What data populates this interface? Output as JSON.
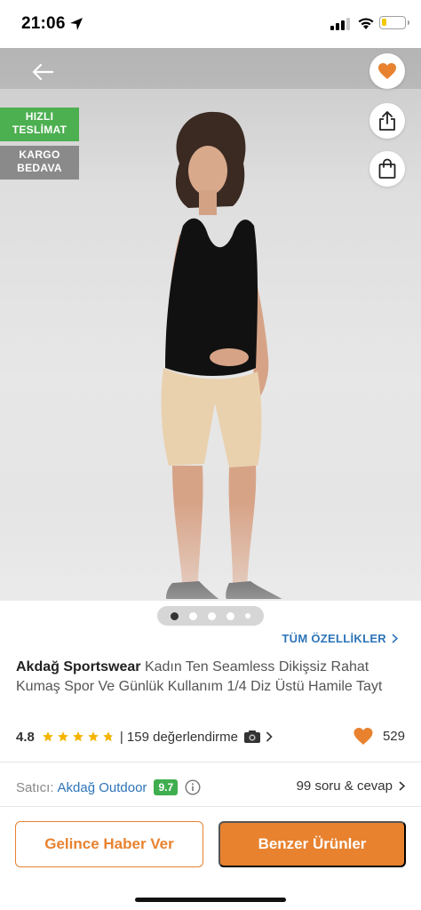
{
  "status_bar": {
    "time": "21:06",
    "battery_level": 0.22,
    "battery_color": "#f2c800"
  },
  "hero": {
    "badges": {
      "fast_delivery_line1": "HIZLI",
      "fast_delivery_line2": "TESLİMAT",
      "free_cargo_line1": "KARGO",
      "free_cargo_line2": "BEDAVA"
    },
    "icons": [
      "back-arrow-icon",
      "heart-icon",
      "share-icon",
      "shopping-bag-icon"
    ],
    "image_count": 5,
    "active_image_index": 1
  },
  "product": {
    "all_features_label": "TÜM ÖZELLİKLER",
    "brand": "Akdağ Sportswear",
    "name": "Kadın Ten Seamless Dikişsiz Rahat Kumaş Spor Ve Günlük Kullanım 1/4 Diz Üstü Hamile Tayt",
    "rating": "4.8",
    "rating_value": 4.8,
    "review_text": "| 159 değerlendirme",
    "favorites_count": "529"
  },
  "seller": {
    "label": "Satıcı:",
    "name": "Akdağ Outdoor",
    "score": "9.7",
    "qa_text": "99 soru & cevap"
  },
  "actions": {
    "notify_label": "Gelince Haber Ver",
    "similar_label": "Benzer Ürünler"
  },
  "colors": {
    "accent_orange": "#e8822f",
    "link_blue": "#2d74b8",
    "badge_green": "#4caf50",
    "seller_score_green": "#3fae4f",
    "star_yellow": "#f5b400"
  }
}
